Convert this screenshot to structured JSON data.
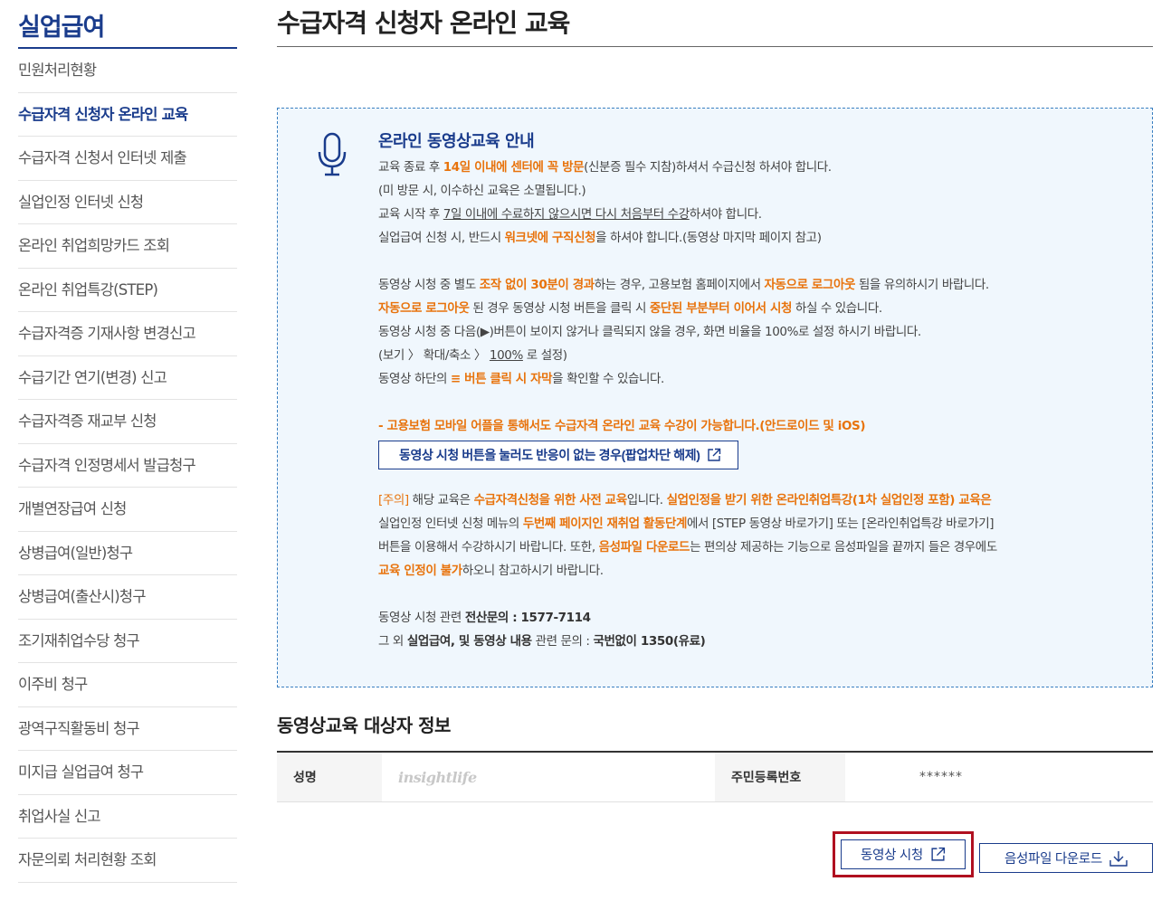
{
  "sidebar": {
    "title": "실업급여",
    "items": [
      {
        "label": "민원처리현황"
      },
      {
        "label": "수급자격 신청자 온라인 교육"
      },
      {
        "label": "수급자격 신청서 인터넷 제출"
      },
      {
        "label": "실업인정 인터넷 신청"
      },
      {
        "label": "온라인 취업희망카드 조회"
      },
      {
        "label": "온라인 취업특강(STEP)"
      },
      {
        "label": "수급자격증 기재사항 변경신고"
      },
      {
        "label": "수급기간 연기(변경) 신고"
      },
      {
        "label": "수급자격증 재교부 신청"
      },
      {
        "label": "수급자격 인정명세서 발급청구"
      },
      {
        "label": "개별연장급여 신청"
      },
      {
        "label": "상병급여(일반)청구"
      },
      {
        "label": "상병급여(출산시)청구"
      },
      {
        "label": "조기재취업수당 청구"
      },
      {
        "label": "이주비 청구"
      },
      {
        "label": "광역구직활동비 청구"
      },
      {
        "label": "미지급 실업급여 청구"
      },
      {
        "label": "취업사실 신고"
      },
      {
        "label": "자문의뢰 처리현황 조회"
      }
    ],
    "active_index": 1
  },
  "page": {
    "title": "수급자격 신청자 온라인 교육"
  },
  "notice": {
    "heading": "온라인 동영상교육 안내",
    "l1a": "교육 종료 후 ",
    "l1b": "14일 이내에 센터에 꼭 방문",
    "l1c": "(신분증 필수 지참)하셔서 수급신청 하셔야 합니다.",
    "l2": "(미 방문 시, 이수하신 교육은 소멸됩니다.)",
    "l3a": "교육 시작 후 ",
    "l3b": "7일 이내에 수료하지 않으시면 다시 처음부터 수강",
    "l3c": "하셔야 합니다.",
    "l4a": "실업급여 신청 시, 반드시 ",
    "l4b": "워크넷에 구직신청",
    "l4c": "을 하셔야 합니다.(동영상 마지막 페이지 참고)",
    "l5a": "동영상 시청 중 별도 ",
    "l5b": "조작 없이 30분이 경과",
    "l5c": "하는 경우, 고용보험 홈페이지에서 ",
    "l5d": "자동으로 로그아웃",
    "l5e": " 됨을 유의하시기 바랍니다.",
    "l6a": "자동으로 로그아웃",
    "l6b": " 된 경우 동영상 시청 버튼을 클릭 시 ",
    "l6c": "중단된 부분부터 이어서 시청",
    "l6d": " 하실 수 있습니다.",
    "l7": "동영상 시청 중 다음(▶)버튼이 보이지 않거나 클릭되지 않을 경우, 화면 비율을 100%로 설정 하시기 바랍니다.",
    "l8a": "(보기 〉 확대/축소 〉 ",
    "l8b": "100%",
    "l8c": " 로 설정)",
    "l9a": "동영상 하단의 ",
    "l9b": "≡ 버튼 클릭 시 자막",
    "l9c": "을 확인할 수 있습니다.",
    "mobile": "- 고용보험 모바일 어플을 통해서도 수급자격 온라인 교육 수강이 가능합니다.(안드로이드 및 iOS)",
    "popup_button": "동영상 시청 버튼을 눌러도 반응이 없는 경우(팝업차단 해제)",
    "c1a": "[주의]",
    "c1b": " 해당 교육은 ",
    "c1c": "수급자격신청을 위한 사전 교육",
    "c1d": "입니다. ",
    "c1e": "실업인정을 받기 위한 온라인취업특강(1차 실업인정 포함) 교육은",
    "c2a": "실업인정 인터넷 신청 메뉴의 ",
    "c2b": "두번째 페이지인 재취업 활동단계",
    "c2c": "에서 [STEP 동영상 바로가기] 또는 [온라인취업특강 바로가기]",
    "c3a": "버튼을 이용해서 수강하시기 바랍니다. 또한, ",
    "c3b": "음성파일 다운로드",
    "c3c": "는 편의상 제공하는 기능으로 음성파일을 끝까지 들은 경우에도",
    "c4a": "교육 인정이 불가",
    "c4b": "하오니 참고하시기 바랍니다.",
    "t1a": "동영상 시청 관련 ",
    "t1b": "전산문의 : 1577-7114",
    "t2a": "그 외 ",
    "t2b": "실업급여, 및 동영상 내용",
    "t2c": " 관련 문의 : ",
    "t2d": "국번없이 1350(유료)"
  },
  "info": {
    "section_title": "동영상교육 대상자 정보",
    "name_label": "성명",
    "name_value": "insightlife",
    "rrn_label": "주민등록번호",
    "rrn_value": "******"
  },
  "actions": {
    "video_button": "동영상 시청",
    "audio_button": "음성파일 다운로드"
  },
  "colors": {
    "brand": "#1a3c8c",
    "accent": "#e8730c",
    "highlight": "#b01020"
  },
  "icons": {
    "notice": "microphone-icon",
    "external": "external-link-icon",
    "download": "download-icon"
  }
}
